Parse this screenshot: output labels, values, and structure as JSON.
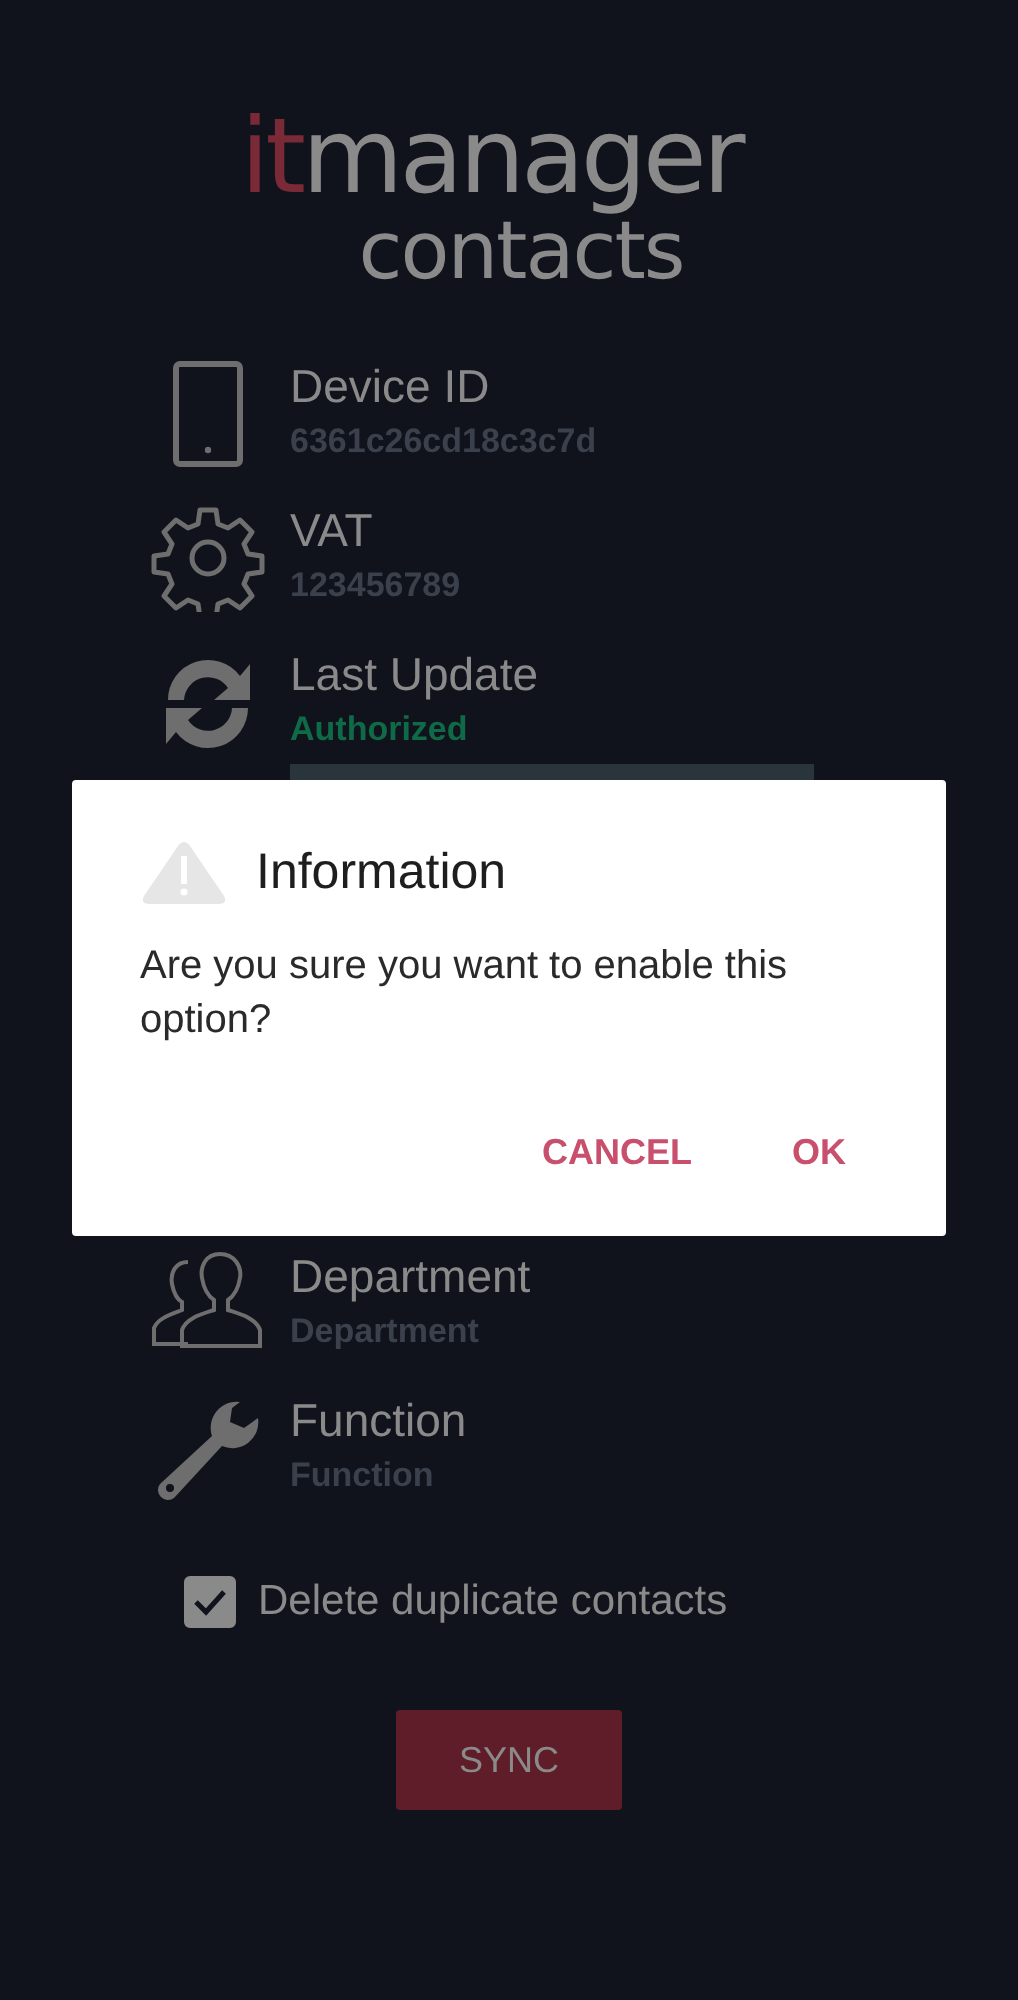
{
  "logo": {
    "prefix": "it",
    "name": "manager",
    "product": "contacts"
  },
  "fields": [
    {
      "kind": "device",
      "label": "Device ID",
      "value": "6361c26cd18c3c7d",
      "highlight": false
    },
    {
      "kind": "settings",
      "label": "VAT",
      "value": "123456789",
      "highlight": false
    },
    {
      "kind": "update",
      "label": "Last Update",
      "value": "Authorized",
      "highlight": true
    },
    {
      "kind": "department",
      "label": "Department",
      "value": "Department",
      "highlight": false
    },
    {
      "kind": "function",
      "label": "Function",
      "value": "Function",
      "highlight": false
    }
  ],
  "checkbox": {
    "label": "Delete duplicate contacts",
    "checked": true
  },
  "sync_button": {
    "label": "SYNC"
  },
  "dialog": {
    "title": "Information",
    "message": "Are you sure you want to enable this option?",
    "buttons": [
      {
        "label": "CANCEL"
      },
      {
        "label": "OK"
      }
    ]
  }
}
